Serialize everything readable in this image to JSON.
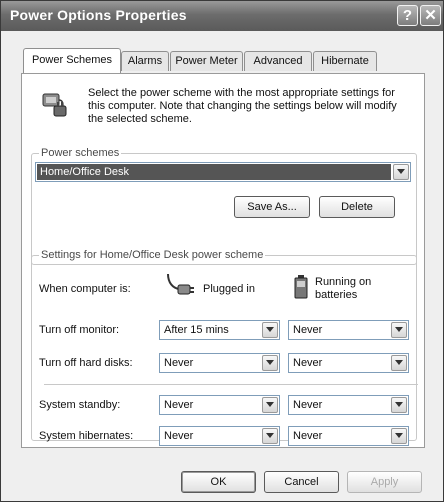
{
  "window": {
    "title": "Power Options Properties",
    "help_glyph": "?",
    "close_glyph": "✕"
  },
  "tabs": [
    {
      "label": "Power Schemes",
      "active": true
    },
    {
      "label": "Alarms",
      "active": false
    },
    {
      "label": "Power Meter",
      "active": false
    },
    {
      "label": "Advanced",
      "active": false
    },
    {
      "label": "Hibernate",
      "active": false
    }
  ],
  "intro": {
    "text": "Select the power scheme with the most appropriate settings for this computer. Note that changing the settings below will modify the selected scheme.",
    "icon": "power-options-icon"
  },
  "power_schemes": {
    "group_label": "Power schemes",
    "selected": "Home/Office Desk",
    "save_as_label": "Save As...",
    "delete_label": "Delete"
  },
  "settings": {
    "group_label": "Settings for Home/Office Desk power scheme",
    "when_label": "When computer is:",
    "plugged_in_label": "Plugged in",
    "batteries_label": "Running on batteries",
    "rows": [
      {
        "label": "Turn off monitor:",
        "plugged": "After 15 mins",
        "battery": "Never"
      },
      {
        "label": "Turn off hard disks:",
        "plugged": "Never",
        "battery": "Never"
      },
      {
        "label": "System standby:",
        "plugged": "Never",
        "battery": "Never"
      },
      {
        "label": "System hibernates:",
        "plugged": "Never",
        "battery": "Never"
      }
    ]
  },
  "footer": {
    "ok_label": "OK",
    "cancel_label": "Cancel",
    "apply_label": "Apply",
    "apply_enabled": false
  },
  "icons": {
    "dropdown": "chevron-down-icon",
    "plug": "plug-icon",
    "battery": "battery-icon"
  }
}
